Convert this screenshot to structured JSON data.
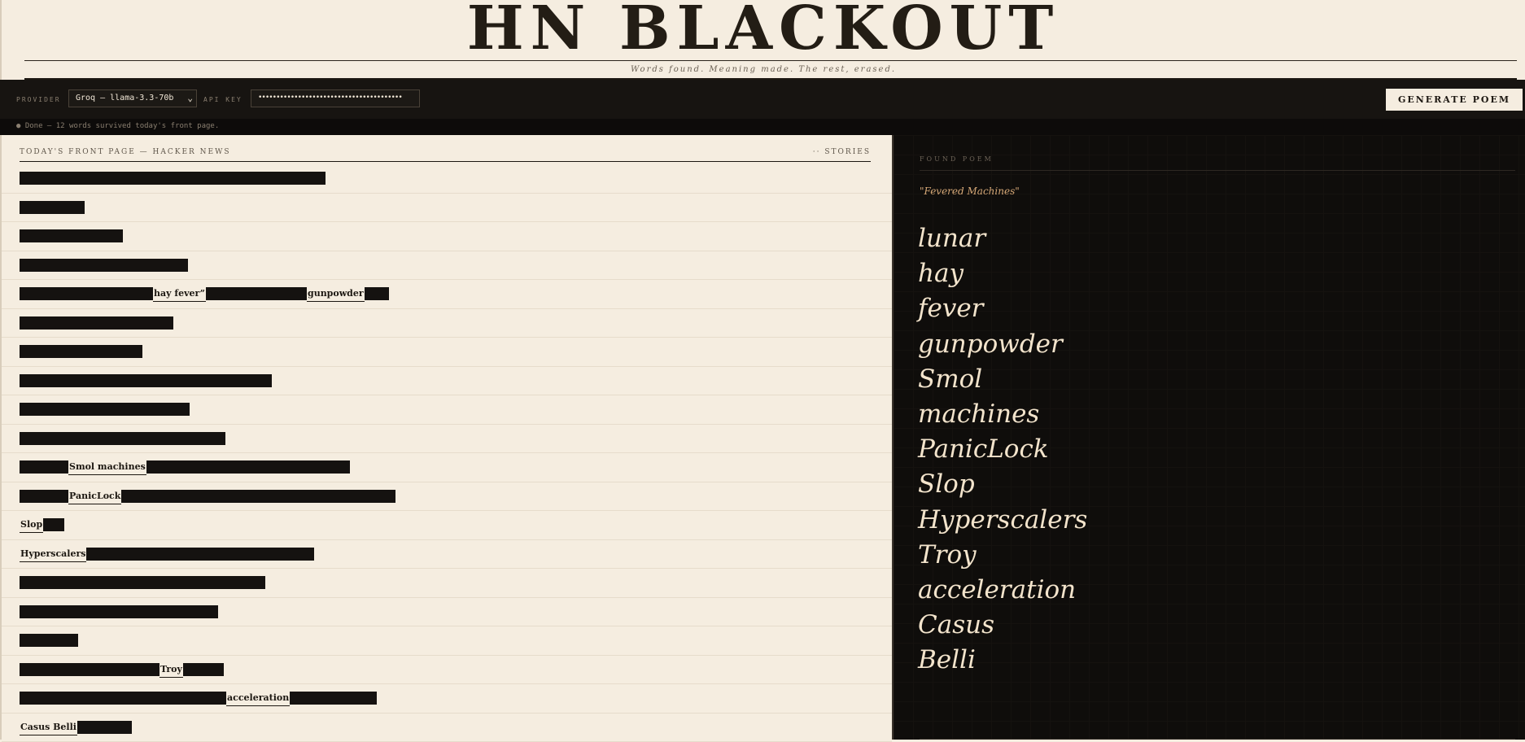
{
  "header": {
    "title": "HN BLACKOUT",
    "tagline": "Words found. Meaning made. The rest, erased."
  },
  "controls": {
    "provider_label": "PROVIDER",
    "provider_value": "Groq — llama-3.3-70b",
    "api_key_label": "API KEY",
    "api_key_value": "••••••••••••••••••••••••••••••••••••••••",
    "generate_label": "GENERATE POEM"
  },
  "status": {
    "text": "● Done — 12 words survived today's front page."
  },
  "front_page": {
    "label": "TODAY'S FRONT PAGE — HACKER NEWS",
    "count": "·· STORIES"
  },
  "stories": [
    {
      "segments": [
        {
          "type": "bar",
          "width": 376
        }
      ]
    },
    {
      "segments": [
        {
          "type": "bar",
          "width": 80
        }
      ]
    },
    {
      "segments": [
        {
          "type": "bar",
          "width": 127
        }
      ]
    },
    {
      "segments": [
        {
          "type": "bar",
          "width": 207
        }
      ]
    },
    {
      "segments": [
        {
          "type": "bar",
          "width": 164
        },
        {
          "type": "word",
          "text": "hay fever”"
        },
        {
          "type": "bar",
          "width": 124
        },
        {
          "type": "word",
          "text": "gunpowder"
        },
        {
          "type": "bar",
          "width": 30
        }
      ]
    },
    {
      "segments": [
        {
          "type": "bar",
          "width": 189
        }
      ]
    },
    {
      "segments": [
        {
          "type": "bar",
          "width": 151
        }
      ]
    },
    {
      "segments": [
        {
          "type": "bar",
          "width": 310
        }
      ]
    },
    {
      "segments": [
        {
          "type": "bar",
          "width": 209
        }
      ]
    },
    {
      "segments": [
        {
          "type": "bar",
          "width": 253
        }
      ]
    },
    {
      "segments": [
        {
          "type": "bar",
          "width": 60
        },
        {
          "type": "word",
          "text": "Smol machines"
        },
        {
          "type": "bar",
          "width": 250
        }
      ]
    },
    {
      "segments": [
        {
          "type": "bar",
          "width": 60
        },
        {
          "type": "word",
          "text": "PanicLock"
        },
        {
          "type": "bar",
          "width": 337
        }
      ]
    },
    {
      "segments": [
        {
          "type": "word",
          "text": "Slop"
        },
        {
          "type": "bar",
          "width": 26
        }
      ]
    },
    {
      "segments": [
        {
          "type": "word",
          "text": "Hyperscalers"
        },
        {
          "type": "bar",
          "width": 280
        }
      ]
    },
    {
      "segments": [
        {
          "type": "bar",
          "width": 302
        }
      ]
    },
    {
      "segments": [
        {
          "type": "bar",
          "width": 244
        }
      ]
    },
    {
      "segments": [
        {
          "type": "bar",
          "width": 72
        }
      ]
    },
    {
      "segments": [
        {
          "type": "bar",
          "width": 172
        },
        {
          "type": "word",
          "text": "Troy"
        },
        {
          "type": "bar",
          "width": 50
        }
      ]
    },
    {
      "segments": [
        {
          "type": "bar",
          "width": 254
        },
        {
          "type": "word",
          "text": "acceleration"
        },
        {
          "type": "bar",
          "width": 107
        }
      ]
    },
    {
      "segments": [
        {
          "type": "word",
          "text": "Casus Belli"
        },
        {
          "type": "bar",
          "width": 67
        }
      ]
    }
  ],
  "poem": {
    "label": "FOUND POEM",
    "title": "\"Fevered Machines\"",
    "lines": [
      "lunar",
      "hay",
      "fever",
      "gunpowder",
      "Smol",
      "machines",
      "PanicLock",
      "Slop",
      "Hyperscalers",
      "Troy",
      "acceleration",
      "Casus",
      "Belli"
    ]
  },
  "colors": {
    "paper": "#f5ede0",
    "ink": "#1c1711",
    "dark_panel": "#0f0d0b",
    "poem_text": "#f3e4cc",
    "poem_title": "#d6a877"
  }
}
